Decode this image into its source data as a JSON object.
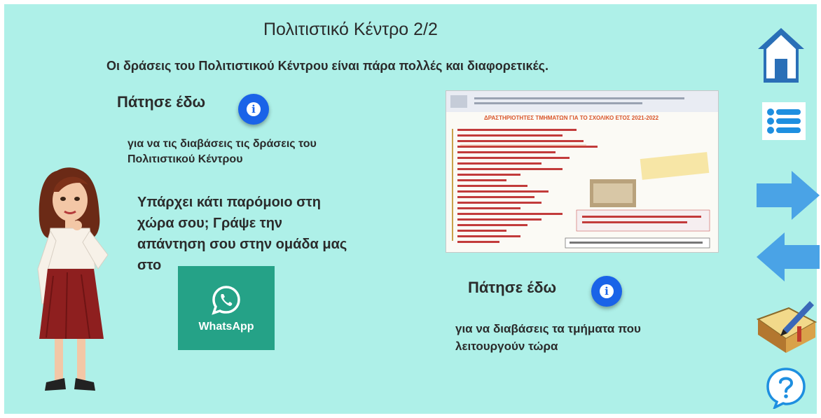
{
  "slide": {
    "title": "Πολιτιστικό Κέντρο 2/2",
    "subtitle": "Οι δράσεις του Πολιτιστικού Κέντρου είναι πάρα πολλές και διαφορετικές."
  },
  "left": {
    "press_label": "Πάτησε έδω",
    "activities_line1": "για να τις διαβάσεις τις δράσεις του",
    "activities_line2": "Πολιτιστικού Κέντρου",
    "question_line1": "Υπάρχει κάτι παρόμοιο στη",
    "question_line2": "χώρα σου; Γράψε την",
    "question_line3": "απάντηση σου στην ομάδα μας",
    "question_line4": "στο",
    "whatsapp_label": "WhatsApp"
  },
  "right": {
    "poster_heading": "ΔΡΑΣΤΗΡΙΟΤΗΤΕΣ ΤΜΗΜΑΤΩΝ ΓΙΑ ΤΟ ΣΧΟΛΙΚΟ ΕΤΟΣ 2021-2022",
    "press_label": "Πάτησε έδω",
    "departments_line1": "για να διαβάσεις τα τμήματα που",
    "departments_line2": "λειτουργούν τώρα"
  },
  "sidebar": {
    "items": [
      "home-icon",
      "menu-list-icon",
      "next-arrow-icon",
      "previous-arrow-icon",
      "notebook-icon",
      "help-icon"
    ]
  },
  "colors": {
    "background": "#aef0e8",
    "info_button": "#1a63e8",
    "arrow": "#4aa3e6",
    "whatsapp": "#25a287",
    "home": "#2a6fb7"
  }
}
